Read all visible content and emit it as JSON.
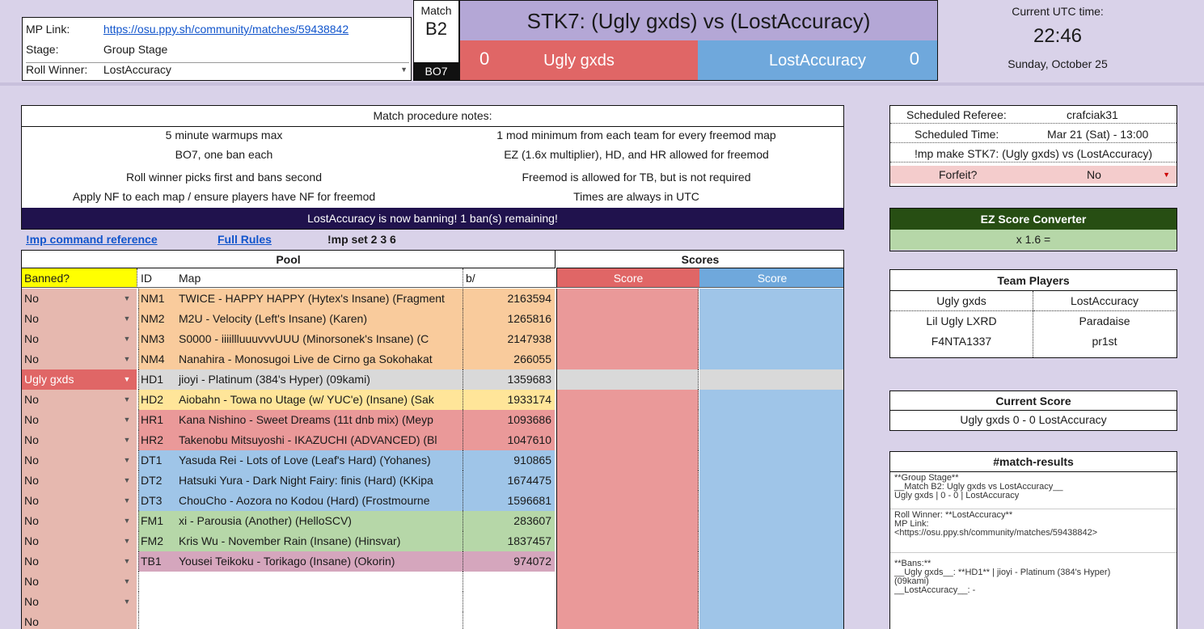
{
  "header": {
    "mp_link_label": "MP Link:",
    "mp_link": "https://osu.ppy.sh/community/matches/59438842",
    "stage_label": "Stage:",
    "stage": "Group Stage",
    "roll_label": "Roll Winner:",
    "roll_winner": "LostAccuracy",
    "match_label": "Match",
    "match_id": "B2",
    "best_of": "BO7",
    "title": "STK7: (Ugly gxds) vs (LostAccuracy)",
    "red_team": "Ugly gxds",
    "red_score": "0",
    "blue_team": "LostAccuracy",
    "blue_score": "0",
    "utc_label": "Current UTC time:",
    "utc_time": "22:46",
    "utc_date": "Sunday, October 25"
  },
  "notes": {
    "title": "Match procedure notes:",
    "left": [
      "5 minute warmups max",
      "BO7, one ban each",
      "Roll winner picks first and bans second",
      "Apply NF to each map / ensure players have NF for freemod"
    ],
    "right": [
      "1 mod minimum from each team for every freemod map",
      "EZ (1.6x multiplier), HD, and HR allowed for freemod",
      "Freemod is allowed for TB, but is not required",
      "Times are always in UTC"
    ],
    "banner": "LostAccuracy is now banning! 1 ban(s) remaining!"
  },
  "links": {
    "mp_ref": "!mp command reference",
    "rules": "Full Rules",
    "mp_set": "!mp set 2 3 6"
  },
  "pool": {
    "title": "Pool",
    "scores_title": "Scores",
    "col_banned": "Banned?",
    "col_id": "ID",
    "col_map": "Map",
    "col_b": "b/",
    "col_score1": "Score",
    "col_score2": "Score",
    "rows": [
      {
        "ban": "No",
        "id": "NM1",
        "map": "TWICE - HAPPY HAPPY (Hytex's Insane) (Fragment",
        "b": "2163594",
        "color": "#f9cb9c"
      },
      {
        "ban": "No",
        "id": "NM2",
        "map": "M2U - Velocity (Left's Insane) (Karen)",
        "b": "1265816",
        "color": "#f9cb9c"
      },
      {
        "ban": "No",
        "id": "NM3",
        "map": "S0000 - iiiillluuuvvvUUU (Minorsonek's Insane) (C",
        "b": "2147938",
        "color": "#f9cb9c"
      },
      {
        "ban": "No",
        "id": "NM4",
        "map": "Nanahira - Monosugoi Live de Cirno ga Sokohakat",
        "b": "266055",
        "color": "#f9cb9c"
      },
      {
        "ban": "Ugly gxds",
        "id": "HD1",
        "map": "jioyi - Platinum (384's Hyper) (09kami)",
        "b": "1359683",
        "color": "#d9d9d9"
      },
      {
        "ban": "No",
        "id": "HD2",
        "map": "Aiobahn - Towa no Utage (w/ YUC'e) (Insane) (Sak",
        "b": "1933174",
        "color": "#ffe599"
      },
      {
        "ban": "No",
        "id": "HR1",
        "map": "Kana Nishino - Sweet Dreams (11t dnb mix) (Meyp",
        "b": "1093686",
        "color": "#ea9999"
      },
      {
        "ban": "No",
        "id": "HR2",
        "map": "Takenobu Mitsuyoshi - IKAZUCHI (ADVANCED) (Bl",
        "b": "1047610",
        "color": "#ea9999"
      },
      {
        "ban": "No",
        "id": "DT1",
        "map": "Yasuda Rei - Lots of Love (Leaf's Hard) (Yohanes)",
        "b": "910865",
        "color": "#9fc5e8"
      },
      {
        "ban": "No",
        "id": "DT2",
        "map": "Hatsuki Yura - Dark Night Fairy: finis (Hard) (KKipa",
        "b": "1674475",
        "color": "#9fc5e8"
      },
      {
        "ban": "No",
        "id": "DT3",
        "map": "ChouCho - Aozora no Kodou (Hard) (Frostmourne",
        "b": "1596681",
        "color": "#9fc5e8"
      },
      {
        "ban": "No",
        "id": "FM1",
        "map": "xi - Parousia (Another) (HelloSCV)",
        "b": "283607",
        "color": "#b6d7a8"
      },
      {
        "ban": "No",
        "id": "FM2",
        "map": "Kris Wu - November Rain (Insane) (Hinsvar)",
        "b": "1837457",
        "color": "#b6d7a8"
      },
      {
        "ban": "No",
        "id": "TB1",
        "map": "Yousei Teikoku - Torikago (Insane) (Okorin)",
        "b": "974072",
        "color": "#d5a6bd"
      },
      {
        "ban": "No",
        "id": "",
        "map": "",
        "b": "",
        "color": "#ffffff"
      },
      {
        "ban": "No",
        "id": "",
        "map": "",
        "b": "",
        "color": "#ffffff"
      },
      {
        "ban": "No",
        "id": "",
        "map": "",
        "b": "",
        "color": "#ffffff"
      }
    ]
  },
  "referee": {
    "ref_label": "Scheduled Referee:",
    "ref": "crafciak31",
    "time_label": "Scheduled Time:",
    "time": "Mar 21 (Sat) - 13:00",
    "make_cmd": "!mp make STK7: (Ugly gxds) vs (LostAccuracy)",
    "forfeit_label": "Forfeit?",
    "forfeit": "No"
  },
  "ez": {
    "title": "EZ Score Converter",
    "formula": "x 1.6 ="
  },
  "team_players": {
    "title": "Team Players",
    "red_name": "Ugly gxds",
    "blue_name": "LostAccuracy",
    "red": [
      "Lil Ugly LXRD",
      "F4NTA1337"
    ],
    "blue": [
      "Paradaise",
      "pr1st"
    ]
  },
  "current_score": {
    "title": "Current Score",
    "value": "Ugly gxds 0 - 0 LostAccuracy"
  },
  "results": {
    "title": "#match-results",
    "block1": "**Group Stage**\n__Match B2: Ugly gxds vs LostAccuracy__\nUgly gxds | 0 - 0 | LostAccuracy",
    "block2": "Roll Winner: **LostAccuracy**\nMP Link:\n<https://osu.ppy.sh/community/matches/59438842>",
    "block3": "**Bans:**\n__Ugly gxds__: **HD1** | jioyi - Platinum (384's Hyper)\n(09kami)\n__LostAccuracy__: -"
  },
  "colors": {
    "red": "#e06666",
    "blue": "#6fa8dc",
    "ban_col": "#e6b8af",
    "score_red": "#ea9999",
    "score_blue": "#9fc5e8",
    "banner": "#20124d",
    "ez_header": "#274e13",
    "ez_body": "#b6d7a8",
    "title_bg": "#b4a7d6"
  }
}
